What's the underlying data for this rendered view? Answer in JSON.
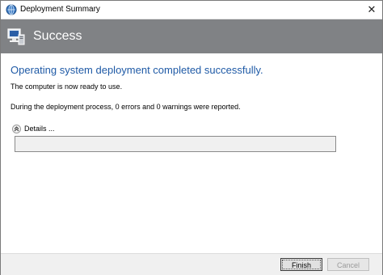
{
  "window": {
    "title": "Deployment Summary",
    "close_glyph": "✕"
  },
  "banner": {
    "title": "Success",
    "icon": "computer-icon",
    "background": "#808285"
  },
  "content": {
    "heading": "Operating system deployment completed successfully.",
    "heading_color": "#1f5aa6",
    "ready_text": "The computer is now ready to use.",
    "report_text": "During the deployment process, 0 errors and 0 warnings were reported."
  },
  "details": {
    "label": "Details ...",
    "expanded": true,
    "value": ""
  },
  "footer": {
    "finish_label": "Finish",
    "cancel_label": "Cancel",
    "cancel_enabled": false
  }
}
